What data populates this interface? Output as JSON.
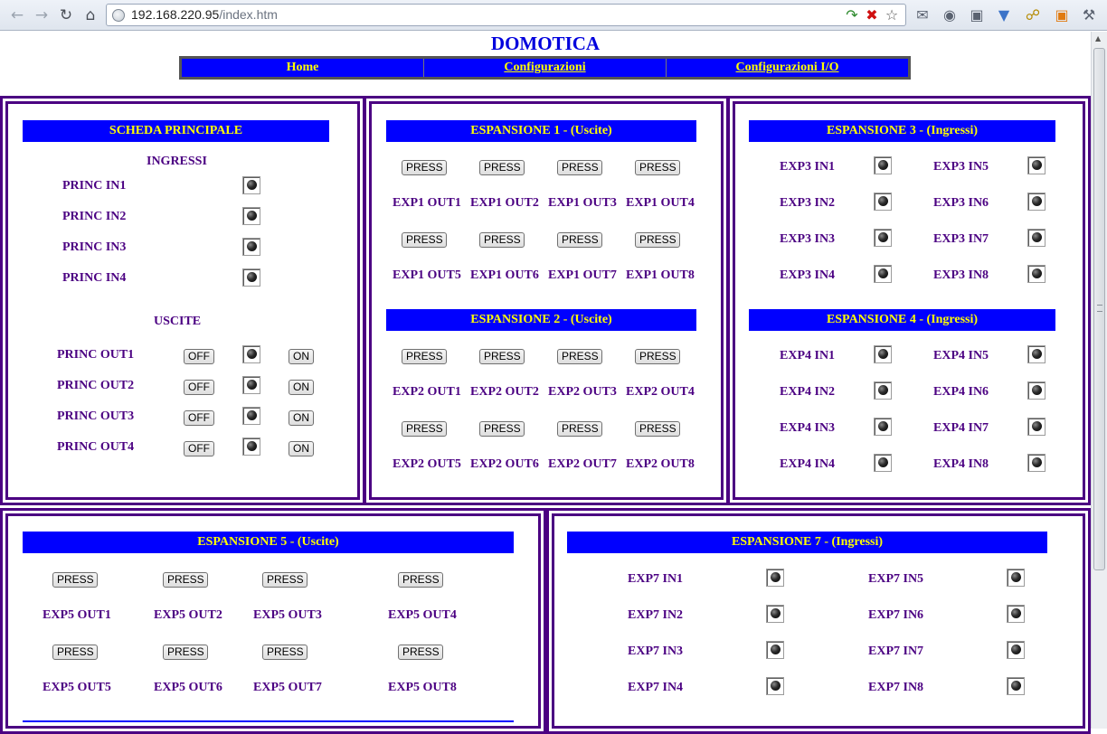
{
  "browser": {
    "url_host": "192.168.220.95",
    "url_path": "/index.htm",
    "back_icon": "arrow-left-icon",
    "forward_icon": "arrow-right-icon",
    "reload_icon": "reload-icon",
    "home_icon": "home-icon"
  },
  "page": {
    "title": "DOMOTICA",
    "menu": [
      {
        "label": "Home"
      },
      {
        "label": "Configurazioni"
      },
      {
        "label": "Configurazioni I/O"
      }
    ]
  },
  "principale": {
    "header": "SCHEDA PRINCIPALE",
    "inputs_title": "INGRESSI",
    "inputs": [
      "PRINC IN1",
      "PRINC IN2",
      "PRINC IN3",
      "PRINC IN4"
    ],
    "outputs_title": "USCITE",
    "outputs": [
      "PRINC OUT1",
      "PRINC OUT2",
      "PRINC OUT3",
      "PRINC OUT4"
    ],
    "off_label": "OFF",
    "on_label": "ON"
  },
  "exp1": {
    "header": "ESPANSIONE 1 - (Uscite)",
    "press_label": "PRESS",
    "outputs": [
      "EXP1 OUT1",
      "EXP1 OUT2",
      "EXP1 OUT3",
      "EXP1 OUT4",
      "EXP1 OUT5",
      "EXP1 OUT6",
      "EXP1 OUT7",
      "EXP1 OUT8"
    ]
  },
  "exp2": {
    "header": "ESPANSIONE 2 - (Uscite)",
    "press_label": "PRESS",
    "outputs": [
      "EXP2 OUT1",
      "EXP2 OUT2",
      "EXP2 OUT3",
      "EXP2 OUT4",
      "EXP2 OUT5",
      "EXP2 OUT6",
      "EXP2 OUT7",
      "EXP2 OUT8"
    ]
  },
  "exp3": {
    "header": "ESPANSIONE 3 - (Ingressi)",
    "inputs": [
      "EXP3 IN1",
      "EXP3 IN2",
      "EXP3 IN3",
      "EXP3 IN4",
      "EXP3 IN5",
      "EXP3 IN6",
      "EXP3 IN7",
      "EXP3 IN8"
    ]
  },
  "exp4": {
    "header": "ESPANSIONE 4 - (Ingressi)",
    "inputs": [
      "EXP4 IN1",
      "EXP4 IN2",
      "EXP4 IN3",
      "EXP4 IN4",
      "EXP4 IN5",
      "EXP4 IN6",
      "EXP4 IN7",
      "EXP4 IN8"
    ]
  },
  "exp5": {
    "header": "ESPANSIONE 5 - (Uscite)",
    "press_label": "PRESS",
    "outputs": [
      "EXP5 OUT1",
      "EXP5 OUT2",
      "EXP5 OUT3",
      "EXP5 OUT4",
      "EXP5 OUT5",
      "EXP5 OUT6",
      "EXP5 OUT7",
      "EXP5 OUT8"
    ]
  },
  "exp7": {
    "header": "ESPANSIONE 7 - (Ingressi)",
    "inputs": [
      "EXP7 IN1",
      "EXP7 IN2",
      "EXP7 IN3",
      "EXP7 IN4",
      "EXP7 IN5",
      "EXP7 IN6",
      "EXP7 IN7",
      "EXP7 IN8"
    ]
  },
  "colors": {
    "header_bg": "#0000ff",
    "header_text": "#ffff00",
    "label_text": "#4b0082",
    "title_text": "#0000dd",
    "panel_border": "#4b0082"
  }
}
